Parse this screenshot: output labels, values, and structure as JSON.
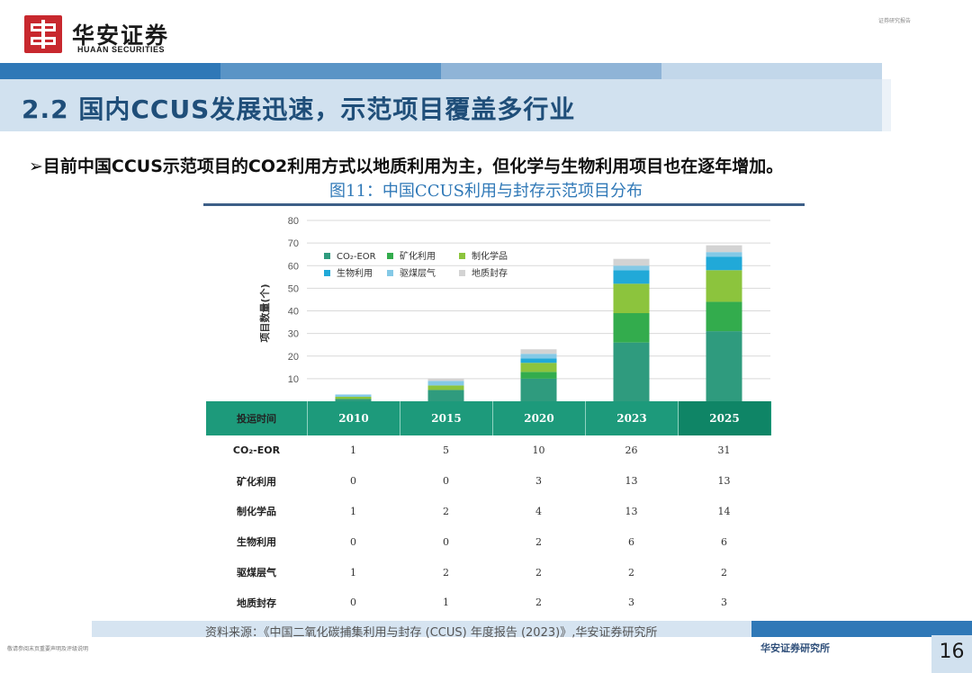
{
  "header": {
    "brand_cn": "华安证券",
    "brand_en": "HUAAN SECURITIES",
    "report_tag": "证券研究报告"
  },
  "title": "2.2 国内CCUS发展迅速，示范项目覆盖多行业",
  "bullet": "目前中国CCUS示范项目的CO2利用方式以地质利用为主，但化学与生物利用项目也在逐年增加。",
  "figure_title": "图11：中国CCUS利用与封存示范项目分布",
  "chart_data": {
    "type": "bar",
    "stacked": true,
    "categories": [
      "2010",
      "2015",
      "2020",
      "2023",
      "2025"
    ],
    "ylabel": "项目数量(个)",
    "ylim": [
      0,
      80
    ],
    "yticks": [
      "10",
      "20",
      "30",
      "40",
      "50",
      "60",
      "70",
      "80"
    ],
    "grid": true,
    "legend_position": "top-left",
    "series": [
      {
        "name": "CO₂-EOR",
        "color": "#2f9b7e",
        "values": [
          1,
          5,
          10,
          26,
          31
        ]
      },
      {
        "name": "矿化利用",
        "color": "#33ac4d",
        "values": [
          0,
          0,
          3,
          13,
          13
        ]
      },
      {
        "name": "制化学品",
        "color": "#8cc43d",
        "values": [
          1,
          2,
          4,
          13,
          14
        ]
      },
      {
        "name": "生物利用",
        "color": "#21a9d8",
        "values": [
          0,
          0,
          2,
          6,
          6
        ]
      },
      {
        "name": "驱煤层气",
        "color": "#84c9e6",
        "values": [
          1,
          2,
          2,
          2,
          2
        ]
      },
      {
        "name": "地质封存",
        "color": "#d3d3d3",
        "values": [
          0,
          1,
          2,
          3,
          3
        ]
      }
    ]
  },
  "table": {
    "header_label": "投运时间",
    "years": [
      "2010",
      "2015",
      "2020",
      "2023",
      "2025"
    ],
    "rows": [
      {
        "label": "CO₂-EOR",
        "values": [
          "1",
          "5",
          "10",
          "26",
          "31"
        ]
      },
      {
        "label": "矿化利用",
        "values": [
          "0",
          "0",
          "3",
          "13",
          "13"
        ]
      },
      {
        "label": "制化学品",
        "values": [
          "1",
          "2",
          "4",
          "13",
          "14"
        ]
      },
      {
        "label": "生物利用",
        "values": [
          "0",
          "0",
          "2",
          "6",
          "6"
        ]
      },
      {
        "label": "驱煤层气",
        "values": [
          "1",
          "2",
          "2",
          "2",
          "2"
        ]
      },
      {
        "label": "地质封存",
        "values": [
          "0",
          "1",
          "2",
          "3",
          "3"
        ]
      }
    ]
  },
  "footer": {
    "source": "资料来源：《中国二氧化碳捕集利用与封存 (CCUS) 年度报告 (2023)》,华安证券研究所",
    "disclaimer": "敬请参阅末页重要声明及评级说明",
    "org": "华安证券研究所",
    "page": "16"
  }
}
